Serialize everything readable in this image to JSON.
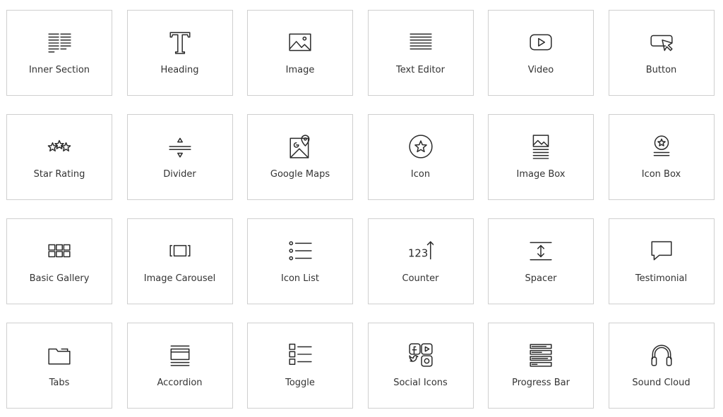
{
  "widgets": [
    {
      "label": "Inner Section",
      "icon": "inner-section-icon"
    },
    {
      "label": "Heading",
      "icon": "heading-icon"
    },
    {
      "label": "Image",
      "icon": "image-icon"
    },
    {
      "label": "Text Editor",
      "icon": "text-editor-icon"
    },
    {
      "label": "Video",
      "icon": "video-icon"
    },
    {
      "label": "Button",
      "icon": "button-icon"
    },
    {
      "label": "Star Rating",
      "icon": "star-rating-icon"
    },
    {
      "label": "Divider",
      "icon": "divider-icon"
    },
    {
      "label": "Google Maps",
      "icon": "google-maps-icon"
    },
    {
      "label": "Icon",
      "icon": "star-circle-icon"
    },
    {
      "label": "Image Box",
      "icon": "image-box-icon"
    },
    {
      "label": "Icon Box",
      "icon": "icon-box-icon"
    },
    {
      "label": "Basic Gallery",
      "icon": "gallery-icon"
    },
    {
      "label": "Image Carousel",
      "icon": "carousel-icon"
    },
    {
      "label": "Icon List",
      "icon": "icon-list-icon"
    },
    {
      "label": "Counter",
      "icon": "counter-icon"
    },
    {
      "label": "Spacer",
      "icon": "spacer-icon"
    },
    {
      "label": "Testimonial",
      "icon": "testimonial-icon"
    },
    {
      "label": "Tabs",
      "icon": "tabs-icon"
    },
    {
      "label": "Accordion",
      "icon": "accordion-icon"
    },
    {
      "label": "Toggle",
      "icon": "toggle-icon"
    },
    {
      "label": "Social Icons",
      "icon": "social-icons-icon"
    },
    {
      "label": "Progress Bar",
      "icon": "progress-bar-icon"
    },
    {
      "label": "Sound Cloud",
      "icon": "headphones-icon"
    }
  ],
  "counter_text": "123"
}
